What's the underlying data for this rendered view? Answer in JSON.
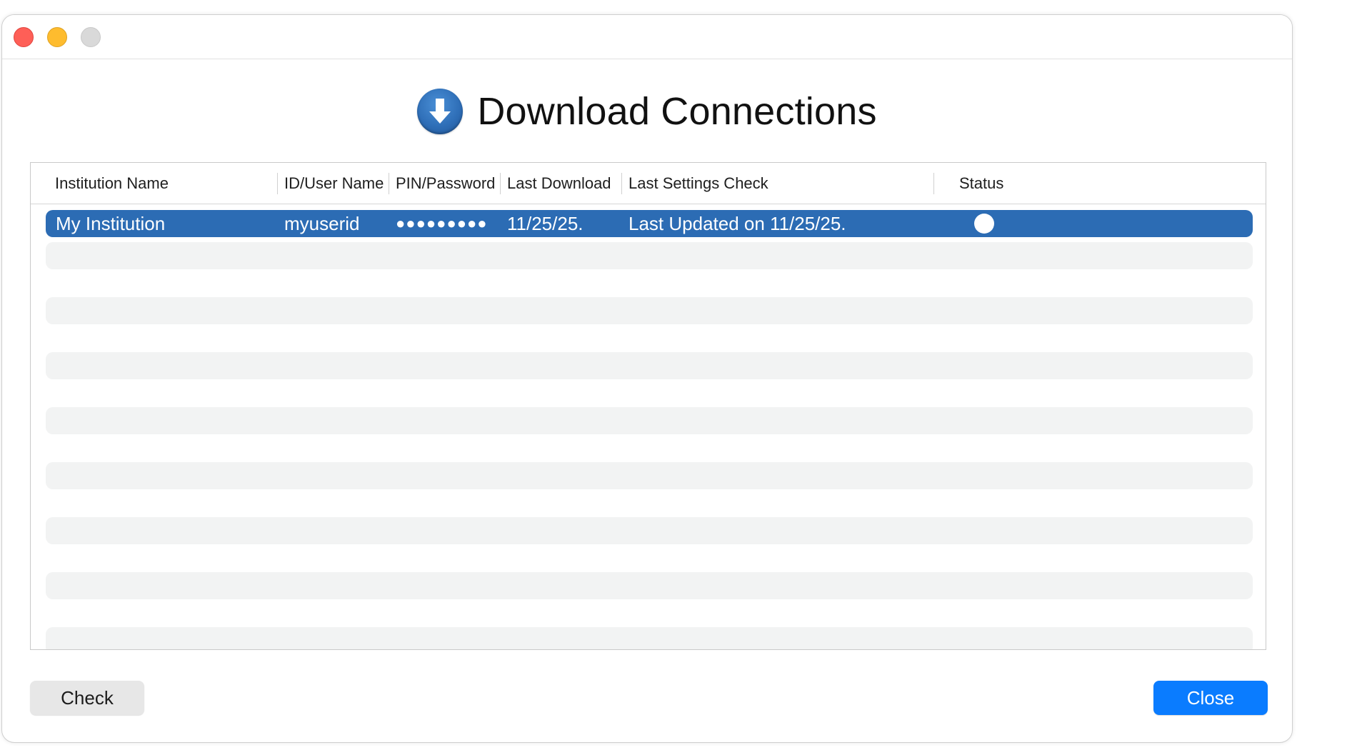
{
  "window": {
    "title": "Download Connections",
    "icon": "download-arrow-icon"
  },
  "table": {
    "columns": [
      "Institution Name",
      "ID/User Name",
      "PIN/Password",
      "Last Download",
      "Last Settings Check",
      "Status"
    ],
    "rows": [
      {
        "institution": "My Institution",
        "user": "myuserid",
        "password": "●●●●●●●●●",
        "last_download": "11/25/25.",
        "last_settings_check": "Last Updated on 11/25/25.",
        "status_icon": "status-circle-icon",
        "selected": true
      }
    ]
  },
  "buttons": {
    "check": "Check",
    "close": "Close"
  },
  "colors": {
    "selection": "#2c6cb4",
    "primary_button": "#0a7cff",
    "stripe": "#f2f3f3"
  }
}
